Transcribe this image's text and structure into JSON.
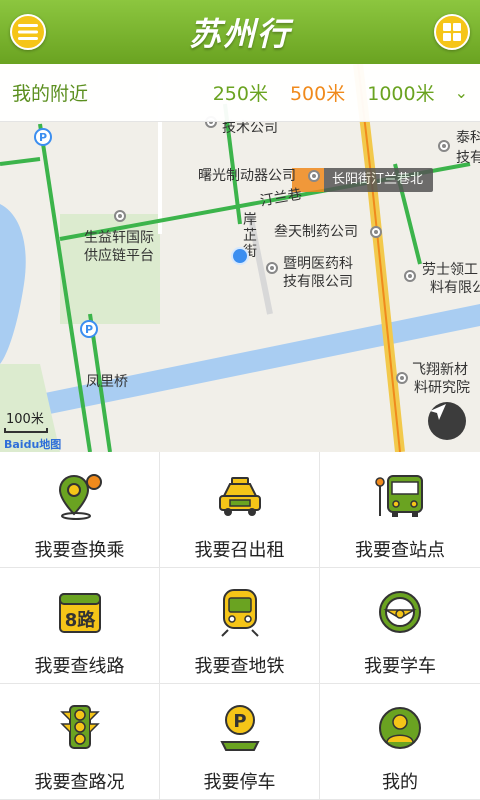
{
  "header": {
    "title": "苏州行",
    "menu_icon": "menu-icon",
    "grid_icon": "grid-icon"
  },
  "nearby": {
    "label": "我的附近",
    "distances": [
      "250米",
      "500米",
      "1000米"
    ],
    "active_distance": "500米"
  },
  "map": {
    "labels": {
      "tech_co": "技术公司",
      "shuguang": "曙光制动器公司",
      "hanlan": "汀兰巷",
      "anzhi": "岸芷街",
      "santian": "叁天制药公司",
      "jiming": "暨明医药科",
      "jiming2": "技有限公司",
      "shengyi": "生益轩国际",
      "shengyi2": "供应链平台",
      "laoshi": "劳士领工",
      "laoshi2": "料有限公",
      "taike": "泰科",
      "taike2": "技有",
      "feixiang": "飞翔新材",
      "feixiang2": "料研究院",
      "fengli": "凤里桥",
      "changyang": "长阳街",
      "nav_chip": "长阳街汀兰巷北"
    },
    "scale": "100米",
    "baidu": "Baidu地图"
  },
  "menu": [
    {
      "label": "我要查换乘",
      "icon": "transfer-pin-icon"
    },
    {
      "label": "我要召出租",
      "icon": "taxi-icon"
    },
    {
      "label": "我要查站点",
      "icon": "bus-stop-icon"
    },
    {
      "label": "我要查线路",
      "icon": "route-8-icon"
    },
    {
      "label": "我要查地铁",
      "icon": "metro-icon"
    },
    {
      "label": "我要学车",
      "icon": "steering-wheel-icon"
    },
    {
      "label": "我要查路况",
      "icon": "traffic-light-icon"
    },
    {
      "label": "我要停车",
      "icon": "parking-icon"
    },
    {
      "label": "我的",
      "icon": "user-icon"
    }
  ],
  "colors": {
    "accent_green": "#6aa321",
    "active_orange": "#f08a1c",
    "icon_yellow": "#f5c518"
  }
}
